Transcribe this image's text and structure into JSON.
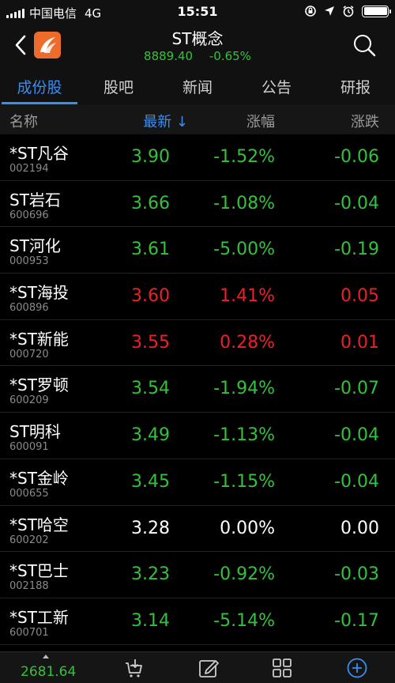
{
  "statusbar": {
    "carrier": "中国电信",
    "network": "4G",
    "time": "15:51"
  },
  "header": {
    "title": "ST概念",
    "index_value": "8889.40",
    "index_change": "-0.65%"
  },
  "tabs": [
    "成份股",
    "股吧",
    "新闻",
    "公告",
    "研报"
  ],
  "columns": {
    "name": "名称",
    "price": "最新 ↓",
    "pct": "涨幅",
    "change": "涨跌"
  },
  "rows": [
    {
      "name": "*ST凡谷",
      "code": "002194",
      "price": "3.90",
      "pct": "-1.52%",
      "change": "-0.06",
      "trend": "down"
    },
    {
      "name": "ST岩石",
      "code": "600696",
      "price": "3.66",
      "pct": "-1.08%",
      "change": "-0.04",
      "trend": "down"
    },
    {
      "name": "ST河化",
      "code": "000953",
      "price": "3.61",
      "pct": "-5.00%",
      "change": "-0.19",
      "trend": "down"
    },
    {
      "name": "*ST海投",
      "code": "600896",
      "price": "3.60",
      "pct": "1.41%",
      "change": "0.05",
      "trend": "up"
    },
    {
      "name": "*ST新能",
      "code": "000720",
      "price": "3.55",
      "pct": "0.28%",
      "change": "0.01",
      "trend": "up"
    },
    {
      "name": "*ST罗顿",
      "code": "600209",
      "price": "3.54",
      "pct": "-1.94%",
      "change": "-0.07",
      "trend": "down"
    },
    {
      "name": "ST明科",
      "code": "600091",
      "price": "3.49",
      "pct": "-1.13%",
      "change": "-0.04",
      "trend": "down"
    },
    {
      "name": "*ST金岭",
      "code": "000655",
      "price": "3.45",
      "pct": "-1.15%",
      "change": "-0.04",
      "trend": "down"
    },
    {
      "name": "*ST哈空",
      "code": "600202",
      "price": "3.28",
      "pct": "0.00%",
      "change": "0.00",
      "trend": "flat"
    },
    {
      "name": "*ST巴士",
      "code": "002188",
      "price": "3.23",
      "pct": "-0.92%",
      "change": "-0.03",
      "trend": "down"
    },
    {
      "name": "*ST工新",
      "code": "600701",
      "price": "3.14",
      "pct": "-5.14%",
      "change": "-0.17",
      "trend": "down"
    }
  ],
  "bottombar": {
    "index_value": "2681.64",
    "icons": [
      "trade-icon",
      "edit-icon",
      "grid-icon",
      "add-icon"
    ]
  },
  "colors": {
    "up": "#ec2027",
    "down": "#33c23b",
    "accent": "#3a8df0",
    "brand": "#ee6c2b"
  }
}
